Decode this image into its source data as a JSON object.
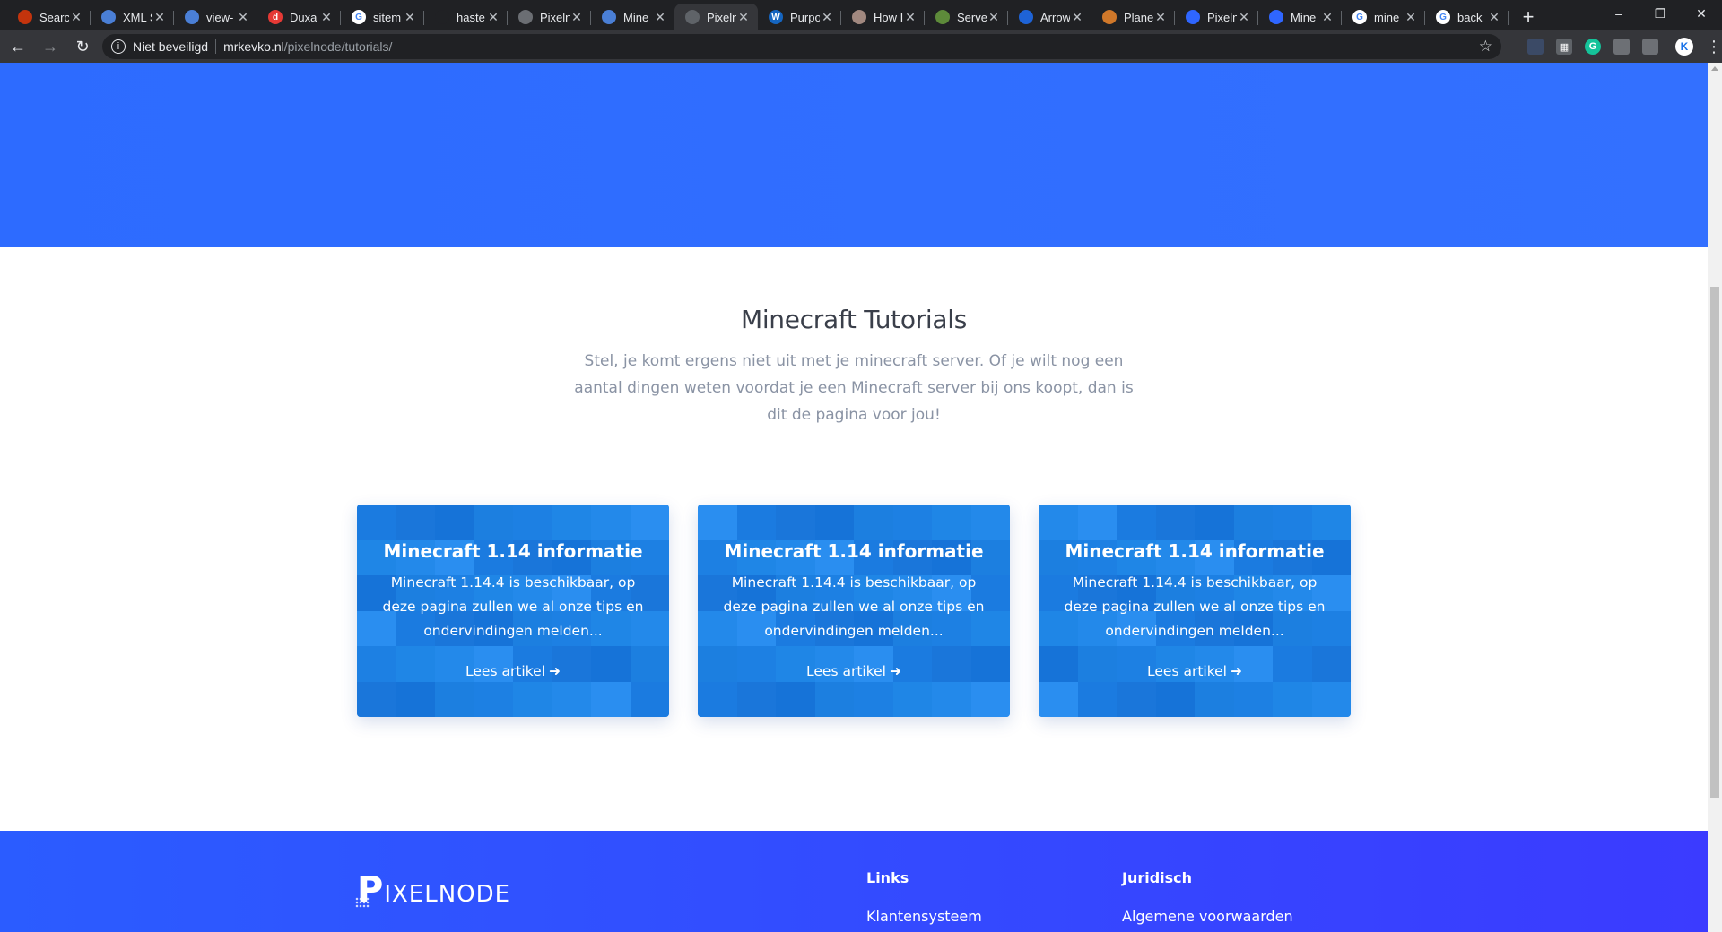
{
  "browser": {
    "tabs": [
      {
        "title": "Searc",
        "fav_color": "#c4340d",
        "fav_glyph": ""
      },
      {
        "title": "XML S",
        "fav_color": "#4a7fd6",
        "fav_glyph": ""
      },
      {
        "title": "view-",
        "fav_color": "#4a7fd6",
        "fav_glyph": ""
      },
      {
        "title": "Duxa",
        "fav_color": "#e53935",
        "fav_glyph": "d"
      },
      {
        "title": "sitem",
        "fav_color": "#ffffff",
        "fav_glyph": "G"
      },
      {
        "title": "haste",
        "fav_color": "#202124",
        "fav_glyph": ""
      },
      {
        "title": "Pixeln",
        "fav_color": "#6b6e73",
        "fav_glyph": ""
      },
      {
        "title": "Mine",
        "fav_color": "#4a7fd6",
        "fav_glyph": ""
      },
      {
        "title": "Pixeln",
        "fav_color": "#5f6368",
        "fav_glyph": "",
        "active": true
      },
      {
        "title": "Purpo",
        "fav_color": "#1565c0",
        "fav_glyph": "W"
      },
      {
        "title": "How I",
        "fav_color": "#a1887f",
        "fav_glyph": ""
      },
      {
        "title": "Serve",
        "fav_color": "#5d8a3a",
        "fav_glyph": ""
      },
      {
        "title": "Arrow",
        "fav_color": "#1e63d6",
        "fav_glyph": ""
      },
      {
        "title": "Plane",
        "fav_color": "#d0782a",
        "fav_glyph": ""
      },
      {
        "title": "Pixeln",
        "fav_color": "#2f66ff",
        "fav_glyph": ""
      },
      {
        "title": "Mine",
        "fav_color": "#2f66ff",
        "fav_glyph": ""
      },
      {
        "title": "mine",
        "fav_color": "#ffffff",
        "fav_glyph": "G"
      },
      {
        "title": "back",
        "fav_color": "#ffffff",
        "fav_glyph": "G"
      }
    ],
    "security_label": "Niet beveiligd",
    "url_host": "mrkevko.nl",
    "url_path": "/pixelnode/tutorials/",
    "profile_initial": "K"
  },
  "page": {
    "section_title": "Minecraft Tutorials",
    "section_subtitle": "Stel, je komt ergens niet uit met je minecraft server. Of je wilt nog een aantal dingen weten voordat je een Minecraft server bij ons koopt, dan is dit de pagina voor jou!",
    "cards": [
      {
        "title": "Minecraft 1.14 informatie",
        "text": "Minecraft 1.14.4 is beschikbaar, op deze pagina zullen we al onze tips en ondervindingen melden...",
        "link": "Lees artikel"
      },
      {
        "title": "Minecraft 1.14 informatie",
        "text": "Minecraft 1.14.4 is beschikbaar, op deze pagina zullen we al onze tips en ondervindingen melden...",
        "link": "Lees artikel"
      },
      {
        "title": "Minecraft 1.14 informatie",
        "text": "Minecraft 1.14.4 is beschikbaar, op deze pagina zullen we al onze tips en ondervindingen melden...",
        "link": "Lees artikel"
      }
    ],
    "footer": {
      "logo_letter": "P",
      "logo_rest": "IXELNODE",
      "links_heading": "Links",
      "links_first": "Klantensysteem",
      "legal_heading": "Juridisch",
      "legal_first": "Algemene voorwaarden"
    }
  },
  "colors": {
    "hero": "#2f6dff",
    "card": "#1c7fe0",
    "footer": "#3348ff"
  }
}
